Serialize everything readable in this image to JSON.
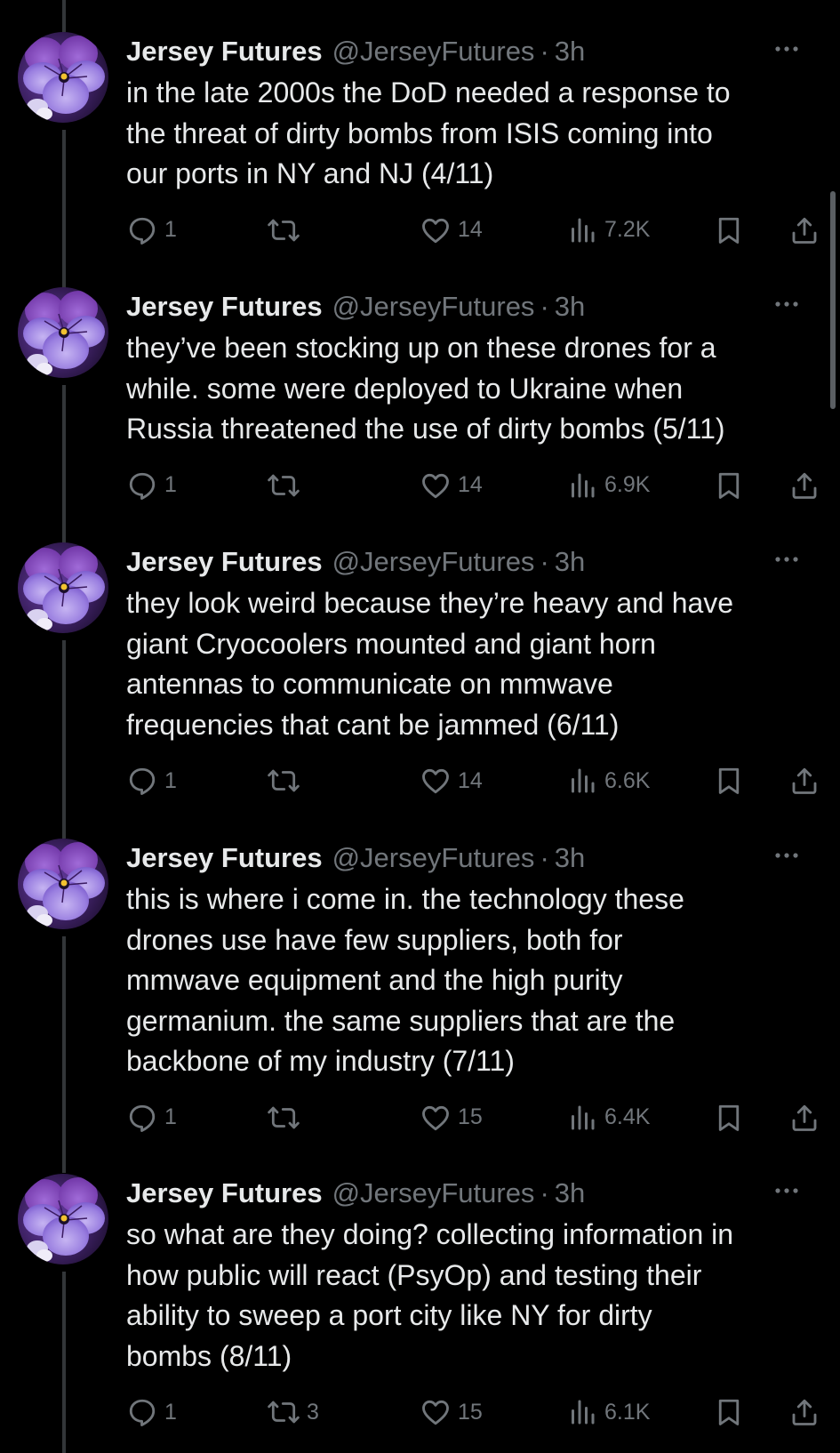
{
  "author": {
    "name": "Jersey Futures",
    "handle": "@JerseyFutures",
    "time": "3h",
    "separator": "·"
  },
  "colors": {
    "background": "#000000",
    "text": "#e7e9ea",
    "muted": "#71767b",
    "thread_line": "#333639",
    "avatar_petal": "#8b5fd6"
  },
  "icons": {
    "reply": "reply-icon",
    "retweet": "retweet-icon",
    "like": "heart-icon",
    "views": "views-icon",
    "bookmark": "bookmark-icon",
    "share": "share-icon",
    "more": "more-icon"
  },
  "tweets": [
    {
      "text": "in the late 2000s the DoD needed a response to\nthe threat of dirty bombs from ISIS coming into\nour ports in NY and NJ (4/11)",
      "replies": "1",
      "retweets": "",
      "likes": "14",
      "views": "7.2K"
    },
    {
      "text": "they’ve been stocking up on these drones for a\nwhile. some were deployed to Ukraine when\nRussia threatened the use of dirty bombs (5/11)",
      "replies": "1",
      "retweets": "",
      "likes": "14",
      "views": "6.9K"
    },
    {
      "text": "they look weird because they’re heavy and have\ngiant Cryocoolers mounted and giant horn\nantennas to communicate on mmwave\nfrequencies that cant be jammed (6/11)",
      "replies": "1",
      "retweets": "",
      "likes": "14",
      "views": "6.6K"
    },
    {
      "text": "this is where i come in. the technology these\ndrones use have few suppliers, both for\nmmwave equipment and the high purity\ngermanium. the same suppliers that are the\nbackbone of my industry (7/11)",
      "replies": "1",
      "retweets": "",
      "likes": "15",
      "views": "6.4K"
    },
    {
      "text": "so what are they doing? collecting information in\nhow public will react (PsyOp) and testing their\nability to sweep a port city like NY for dirty\nbombs (8/11)",
      "replies": "1",
      "retweets": "3",
      "likes": "15",
      "views": "6.1K"
    }
  ]
}
